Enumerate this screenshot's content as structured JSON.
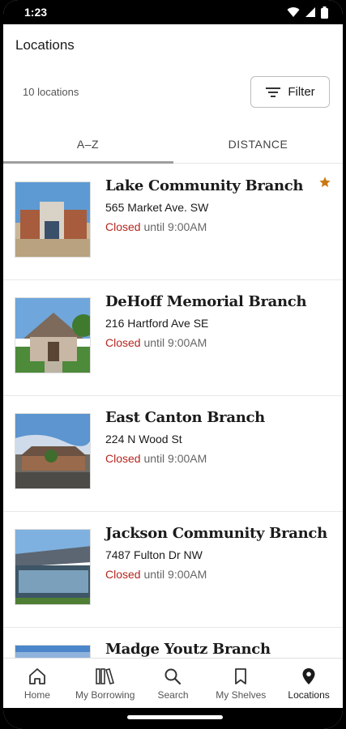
{
  "status_bar": {
    "time": "1:23"
  },
  "header": {
    "title": "Locations",
    "count": "10 locations",
    "filter_label": "Filter"
  },
  "tabs": [
    {
      "label": "A–Z",
      "active": true
    },
    {
      "label": "DISTANCE",
      "active": false
    }
  ],
  "locations": [
    {
      "name": "Lake Community Branch",
      "address": "565 Market Ave. SW",
      "status": "Closed",
      "until": " until 9:00AM",
      "favorite": true
    },
    {
      "name": "DeHoff Memorial Branch",
      "address": "216 Hartford Ave SE",
      "status": "Closed",
      "until": " until 9:00AM",
      "favorite": false
    },
    {
      "name": "East Canton Branch",
      "address": "224  N Wood St",
      "status": "Closed",
      "until": " until 9:00AM",
      "favorite": false
    },
    {
      "name": "Jackson Community Branch",
      "address": "7487 Fulton Dr NW",
      "status": "Closed",
      "until": " until 9:00AM",
      "favorite": false
    },
    {
      "name": "Madge Youtz Branch",
      "address": "",
      "status": "",
      "until": "",
      "favorite": false
    }
  ],
  "bottom_nav": [
    {
      "label": "Home",
      "icon": "home-icon"
    },
    {
      "label": "My Borrowing",
      "icon": "books-icon"
    },
    {
      "label": "Search",
      "icon": "search-icon"
    },
    {
      "label": "My Shelves",
      "icon": "bookmark-icon"
    },
    {
      "label": "Locations",
      "icon": "location-pin-icon",
      "active": true
    }
  ],
  "colors": {
    "closed": "#b3261e",
    "favorite_star": "#c77a12",
    "tab_indicator": "#9e9e9e"
  }
}
